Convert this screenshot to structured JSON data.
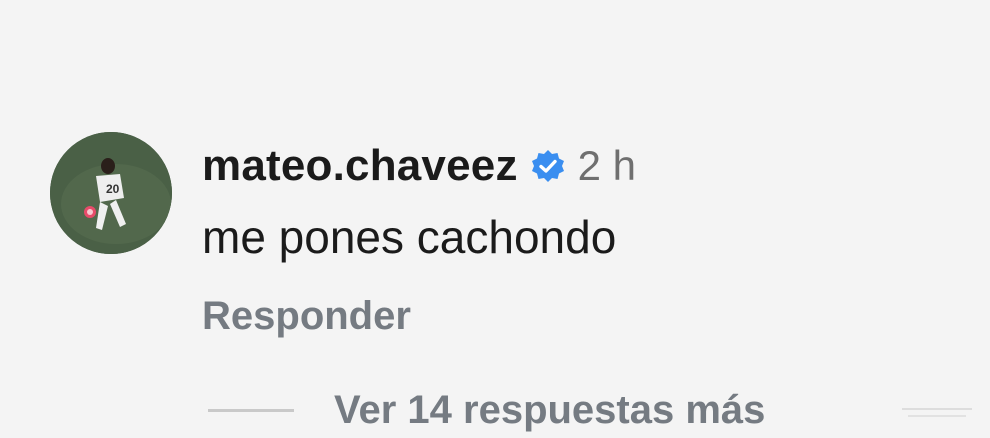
{
  "comment": {
    "username": "mateo.chaveez",
    "verified": true,
    "time": "2 h",
    "text": "me pones cachondo",
    "reply_label": "Responder",
    "view_replies_label": "Ver 14 respuestas más"
  },
  "avatar": {
    "jersey_number": "20"
  },
  "icons": {
    "verified_badge": "verified-badge-icon"
  },
  "colors": {
    "background": "#f4f4f4",
    "text_primary": "#1b1b1b",
    "text_secondary": "#757b82",
    "verified_blue": "#3a8ef0"
  }
}
